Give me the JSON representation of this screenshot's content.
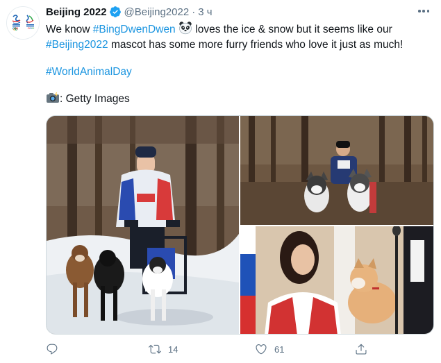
{
  "tweet": {
    "author_name": "Beijing 2022",
    "handle": "@Beijing2022",
    "separator": "·",
    "time": "3 ч",
    "verified": true,
    "lines": {
      "l1_pre": "We know ",
      "l1_tag": "#BingDwenDwen",
      "l1_post": " loves the ice & snow but it seems like our",
      "l2_tag": "#Beijing2022",
      "l2_post": " mascot has some more furry friends who love it just as much!",
      "l3_tag": "#WorldAnimalDay",
      "l4_text": ": Getty Images"
    },
    "emoji": {
      "after_tag": "panda-face",
      "camera": "camera-with-flash"
    },
    "media": [
      {
        "name": "sled-dog-musher-photo"
      },
      {
        "name": "husky-team-forest-photo"
      },
      {
        "name": "athlete-with-akita-photo"
      }
    ],
    "actions": {
      "reply_count": "",
      "retweet_count": "14",
      "like_count": "61"
    }
  },
  "colors": {
    "link": "#1b95e0",
    "secondary": "#5b7083",
    "verified": "#1da1f2",
    "text": "#0f1419"
  }
}
